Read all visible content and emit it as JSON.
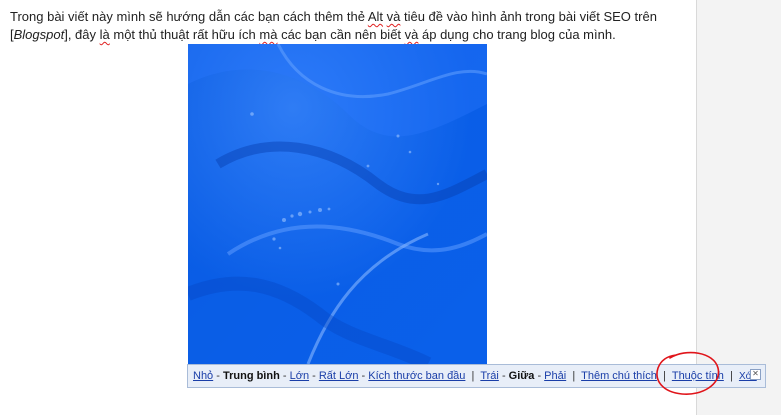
{
  "post": {
    "text_before": "Trong bài viết này mình sẽ hướng dẫn các bạn cách thêm thẻ ",
    "alt_word": "Alt",
    "text_mid1": " ",
    "va_word": "và",
    "text_mid2": " tiêu đề vào hình ảnh trong bài viết SEO trên [",
    "blogspot_word": "Blogspot",
    "text_mid3": "], đây ",
    "la_word": "là",
    "text_mid4": " một thủ thuật rất hữu ích ",
    "ma_word": "mà",
    "text_mid5": " các bạn cần nên biết ",
    "va2_word": "và",
    "text_after": " áp dụng cho trang blog của mình."
  },
  "image": {
    "dominant_color": "#0a5fe8"
  },
  "toolbar": {
    "size_small": "Nhỏ",
    "size_medium": "Trung bình",
    "size_large": "Lớn",
    "size_xlarge": "Rất Lớn",
    "size_original": "Kích thước ban đầu",
    "align_left": "Trái",
    "align_center": "Giữa",
    "align_right": "Phải",
    "add_caption": "Thêm chú thích",
    "properties": "Thuộc tính",
    "remove": "Xóa",
    "close_icon": "close-icon"
  },
  "colors": {
    "link": "#1a3ea8",
    "toolbar_bg": "#e8eef8",
    "annotation": "#e0141a",
    "side_panel": "#f3f3f3"
  }
}
